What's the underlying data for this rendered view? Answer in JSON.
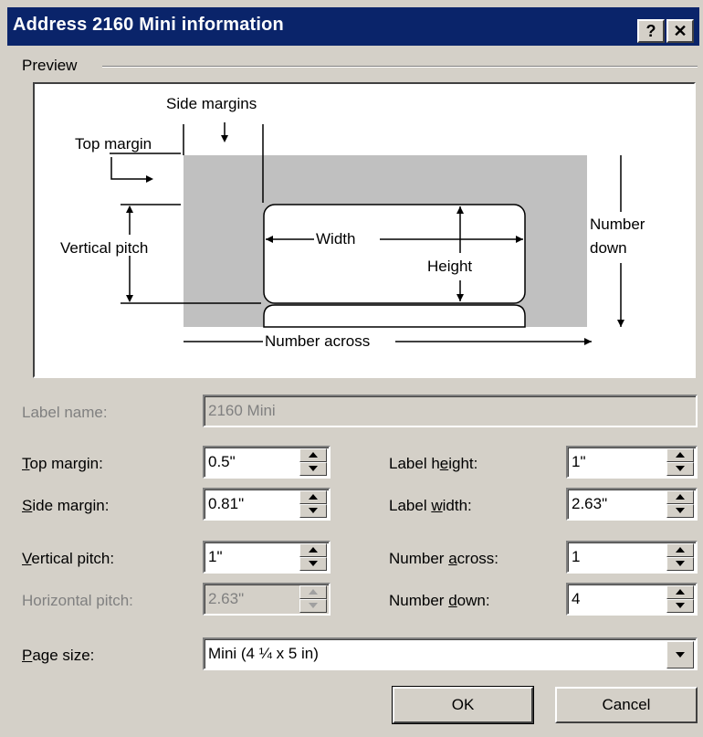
{
  "window": {
    "title": "Address 2160 Mini information",
    "help_label": "?",
    "close_label": "✕"
  },
  "preview": {
    "group_label": "Preview",
    "side_margins": "Side margins",
    "top_margin": "Top margin",
    "vertical_pitch": "Vertical pitch",
    "width": "Width",
    "height": "Height",
    "number_down_1": "Number",
    "number_down_2": "down",
    "number_across": "Number across"
  },
  "form": {
    "label_name": {
      "label": "Label name:",
      "value": "2160 Mini"
    },
    "top_margin": {
      "label_u": "T",
      "label_rest": "op margin:",
      "value": "0.5\""
    },
    "side_margin": {
      "label_u": "S",
      "label_rest": "ide margin:",
      "value": "0.81\""
    },
    "vertical_pitch": {
      "label_u": "V",
      "label_rest": "ertical pitch:",
      "value": "1\""
    },
    "horizontal_pitch": {
      "label": "Horizontal pitch:",
      "value": "2.63\""
    },
    "label_height": {
      "label_pre": "Label h",
      "label_u": "e",
      "label_rest": "ight:",
      "value": "1\""
    },
    "label_width": {
      "label_pre": "Label ",
      "label_u": "w",
      "label_rest": "idth:",
      "value": "2.63\""
    },
    "number_across": {
      "label_pre": "Number ",
      "label_u": "a",
      "label_rest": "cross:",
      "value": "1"
    },
    "number_down": {
      "label_pre": "Number ",
      "label_u": "d",
      "label_rest": "own:",
      "value": "4"
    },
    "page_size": {
      "label_u": "P",
      "label_rest": "age size:",
      "value": "Mini (4 ¼ x 5 in)"
    }
  },
  "buttons": {
    "ok": "OK",
    "cancel": "Cancel"
  },
  "colors": {
    "titlebar": "#0a246a",
    "face": "#d4d0c8",
    "label_gray": "#c0c0c0"
  }
}
